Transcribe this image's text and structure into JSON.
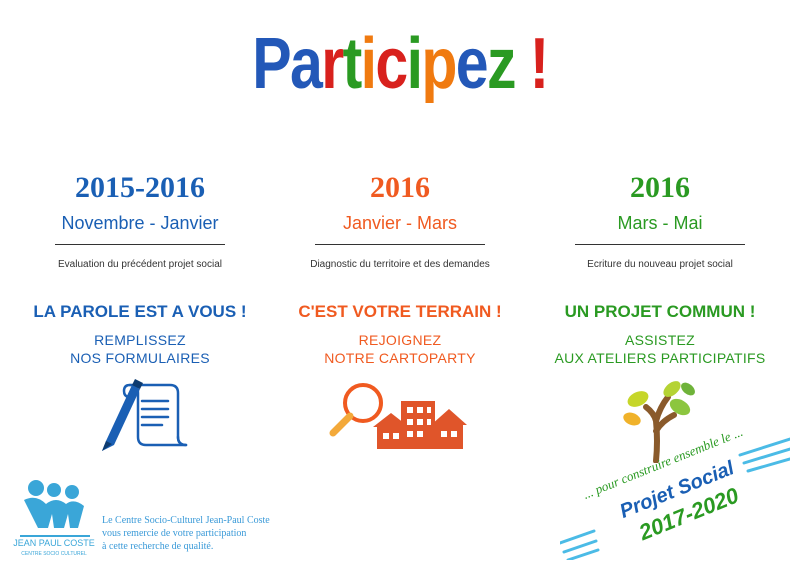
{
  "header": {
    "title_letters": [
      {
        "ch": "P",
        "color": "#2358b8"
      },
      {
        "ch": "a",
        "color": "#2358b8"
      },
      {
        "ch": "r",
        "color": "#d8211d"
      },
      {
        "ch": "t",
        "color": "#2a9a22"
      },
      {
        "ch": "i",
        "color": "#f07a10"
      },
      {
        "ch": "c",
        "color": "#d8211d"
      },
      {
        "ch": "i",
        "color": "#2a9a22"
      },
      {
        "ch": "p",
        "color": "#f07a10"
      },
      {
        "ch": "e",
        "color": "#2358b8"
      },
      {
        "ch": "z",
        "color": "#2a9a22"
      },
      {
        "ch": " ",
        "color": "#ffffff"
      },
      {
        "ch": "!",
        "color": "#d8211d"
      }
    ]
  },
  "columns": [
    {
      "year": "2015-2016",
      "period": "Novembre - Janvier",
      "description": "Evaluation du précédent projet social",
      "slogan": "LA PAROLE EST A VOUS !",
      "action_line1": "REMPLISSEZ",
      "action_line2": "NOS FORMULAIRES",
      "color": "#1a5fb4",
      "icon": "pen-and-scroll-icon"
    },
    {
      "year": "2016",
      "period": "Janvier - Mars",
      "description": "Diagnostic du territoire et des demandes",
      "slogan": "C'EST VOTRE TERRAIN !",
      "action_line1": "REJOIGNEZ",
      "action_line2": "NOTRE CARTOPARTY",
      "color": "#f05a20",
      "icon": "magnifier-houses-icon"
    },
    {
      "year": "2016",
      "period": "Mars - Mai",
      "description": "Ecriture du nouveau projet social",
      "slogan": "UN PROJET COMMUN !",
      "action_line1": "ASSISTEZ",
      "action_line2": "AUX ATELIERS PARTICIPATIFS",
      "color": "#2a9a22",
      "icon": "growing-tree-icon"
    }
  ],
  "footer": {
    "logo_text": "JEAN PAUL COSTE",
    "logo_subtext": "CENTRE SOCIO CULTUREL",
    "thanks_line1": "Le Centre Socio-Culturel Jean-Paul Coste",
    "thanks_line2": "vous remercie de votre participation",
    "thanks_line3": "à cette recherche de qualité."
  },
  "stamp": {
    "tagline": "... pour construire ensemble le ...",
    "name": "Projet Social",
    "years": "2017-2020"
  }
}
